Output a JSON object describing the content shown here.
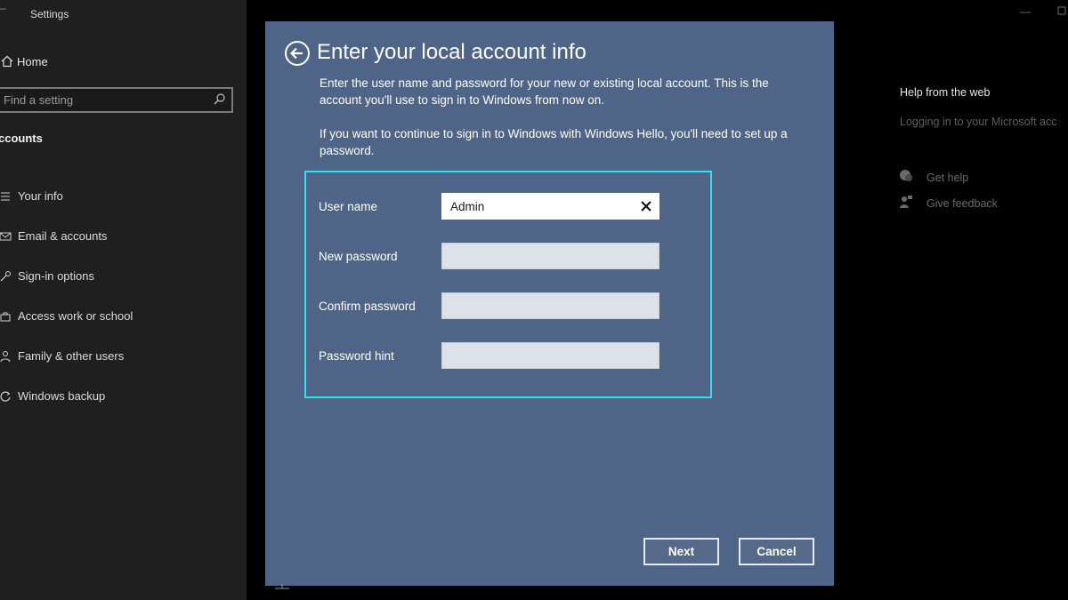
{
  "window": {
    "title": "Settings",
    "title_dash": "–"
  },
  "sidebar": {
    "home_label": "Home",
    "search_placeholder": "Find a setting",
    "section_title": "ccounts",
    "items": [
      {
        "label": "Your info",
        "icon": "person-card-icon"
      },
      {
        "label": "Email & accounts",
        "icon": "mail-icon"
      },
      {
        "label": "Sign-in options",
        "icon": "key-icon"
      },
      {
        "label": "Access work or school",
        "icon": "briefcase-icon"
      },
      {
        "label": "Family & other users",
        "icon": "people-icon"
      },
      {
        "label": "Windows backup",
        "icon": "sync-icon"
      }
    ]
  },
  "help_panel": {
    "title": "Help from the web",
    "link": "Logging in to your Microsoft acc",
    "get_help": "Get help",
    "give_feedback": "Give feedback"
  },
  "dialog": {
    "title": "Enter your local account info",
    "paragraph1": "Enter the user name and password for your new or existing local account. This is the account you'll use to sign in to Windows from now on.",
    "paragraph2": "If you want to continue to sign in to Windows with Windows Hello, you'll need to set up a password.",
    "fields": [
      {
        "label": "User name",
        "value": "Admin"
      },
      {
        "label": "New password",
        "value": ""
      },
      {
        "label": "Confirm password",
        "value": ""
      },
      {
        "label": "Password hint",
        "value": ""
      }
    ],
    "next_label": "Next",
    "cancel_label": "Cancel"
  },
  "colors": {
    "dialog_bg": "#4f6587",
    "highlight_frame": "#2fe0f2",
    "sidebar_bg": "#1f1f1f"
  }
}
